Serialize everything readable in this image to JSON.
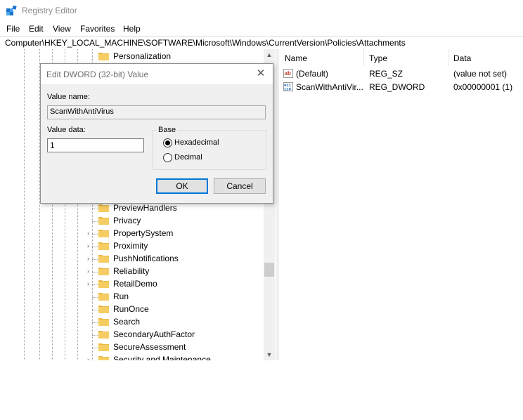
{
  "window": {
    "title": "Registry Editor",
    "menu": [
      "File",
      "Edit",
      "View",
      "Favorites",
      "Help"
    ],
    "address": "Computer\\HKEY_LOCAL_MACHINE\\SOFTWARE\\Microsoft\\Windows\\CurrentVersion\\Policies\\Attachments"
  },
  "tree": {
    "items": [
      {
        "label": "Personalization"
      },
      {
        "label": "PreviewHandlers"
      },
      {
        "label": "Privacy"
      },
      {
        "label": "PropertySystem"
      },
      {
        "label": "Proximity"
      },
      {
        "label": "PushNotifications"
      },
      {
        "label": "Reliability"
      },
      {
        "label": "RetailDemo"
      },
      {
        "label": "Run"
      },
      {
        "label": "RunOnce"
      },
      {
        "label": "Search"
      },
      {
        "label": "SecondaryAuthFactor"
      },
      {
        "label": "SecureAssessment"
      },
      {
        "label": "Security and Maintenance"
      }
    ]
  },
  "list": {
    "columns": [
      "Name",
      "Type",
      "Data"
    ],
    "rows": [
      {
        "name": "(Default)",
        "type": "REG_SZ",
        "data": "(value not set)",
        "icon": "string-value-icon"
      },
      {
        "name": "ScanWithAntiVir...",
        "type": "REG_DWORD",
        "data": "0x00000001 (1)",
        "icon": "binary-value-icon"
      }
    ]
  },
  "dialog": {
    "title": "Edit DWORD (32-bit) Value",
    "value_name_label": "Value name:",
    "value_name": "ScanWithAntiVirus",
    "value_data_label": "Value data:",
    "value_data": "1",
    "base_label": "Base",
    "hex_label": "Hexadecimal",
    "dec_label": "Decimal",
    "selected_base": "Hexadecimal",
    "ok_label": "OK",
    "cancel_label": "Cancel"
  },
  "colors": {
    "folder": "#e8b84a",
    "accent": "#0078d7"
  }
}
